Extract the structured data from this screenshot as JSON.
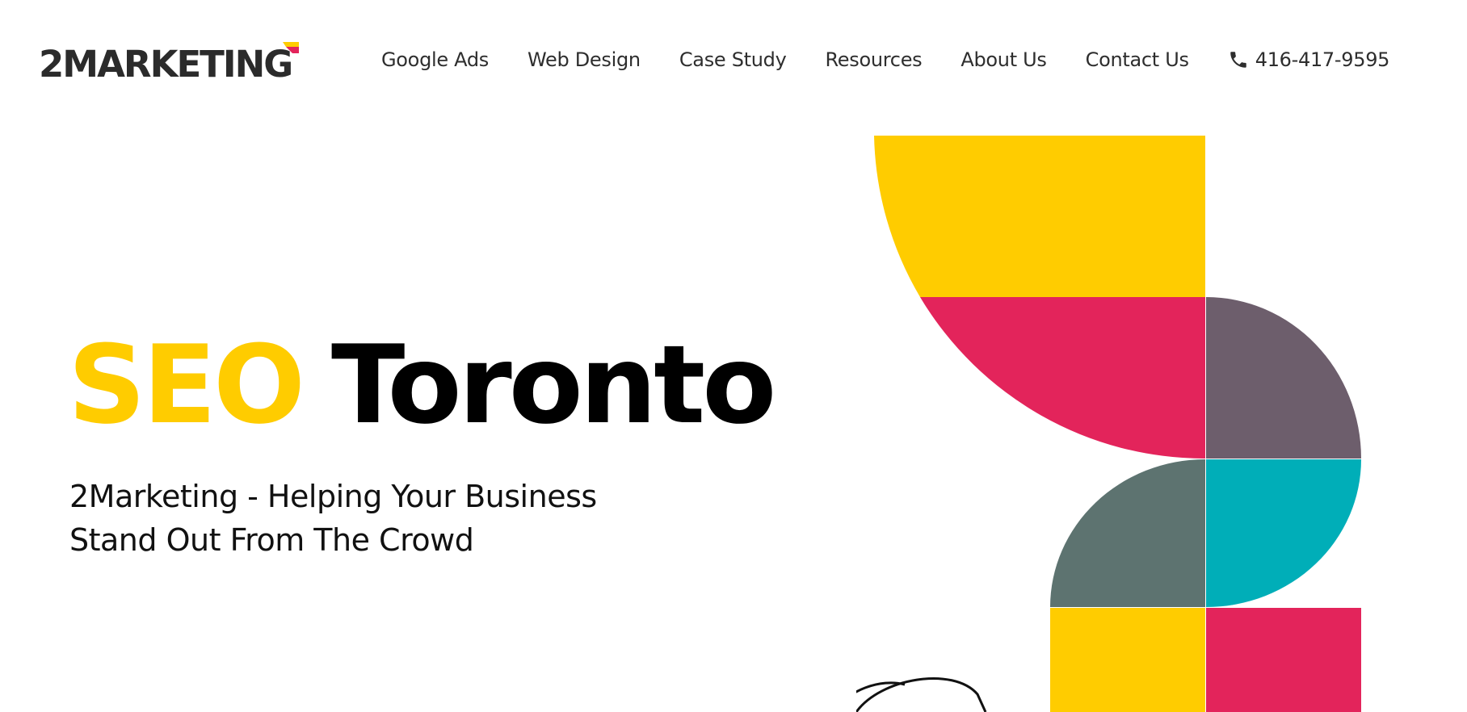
{
  "brand": {
    "name": "2MARKETING",
    "mark_colors": [
      "#ffcc00",
      "#e3245b"
    ]
  },
  "nav": {
    "items": [
      {
        "label": "Google Ads"
      },
      {
        "label": "Web Design"
      },
      {
        "label": "Case Study"
      },
      {
        "label": "Resources"
      },
      {
        "label": "About Us"
      },
      {
        "label": "Contact Us"
      }
    ],
    "phone": {
      "icon": "phone-icon",
      "number": "416-417-9595"
    }
  },
  "hero": {
    "title_highlight": "SEO",
    "title_rest": "Toronto",
    "subtitle_line1": "2Marketing - Helping Your Business",
    "subtitle_line2": "Stand Out From The Crowd"
  },
  "colors": {
    "yellow": "#ffcc00",
    "crimson": "#e3245b",
    "mauve": "#6d5e6c",
    "slate": "#5d7370",
    "teal": "#00aeb8",
    "text": "#2e2e2e"
  }
}
